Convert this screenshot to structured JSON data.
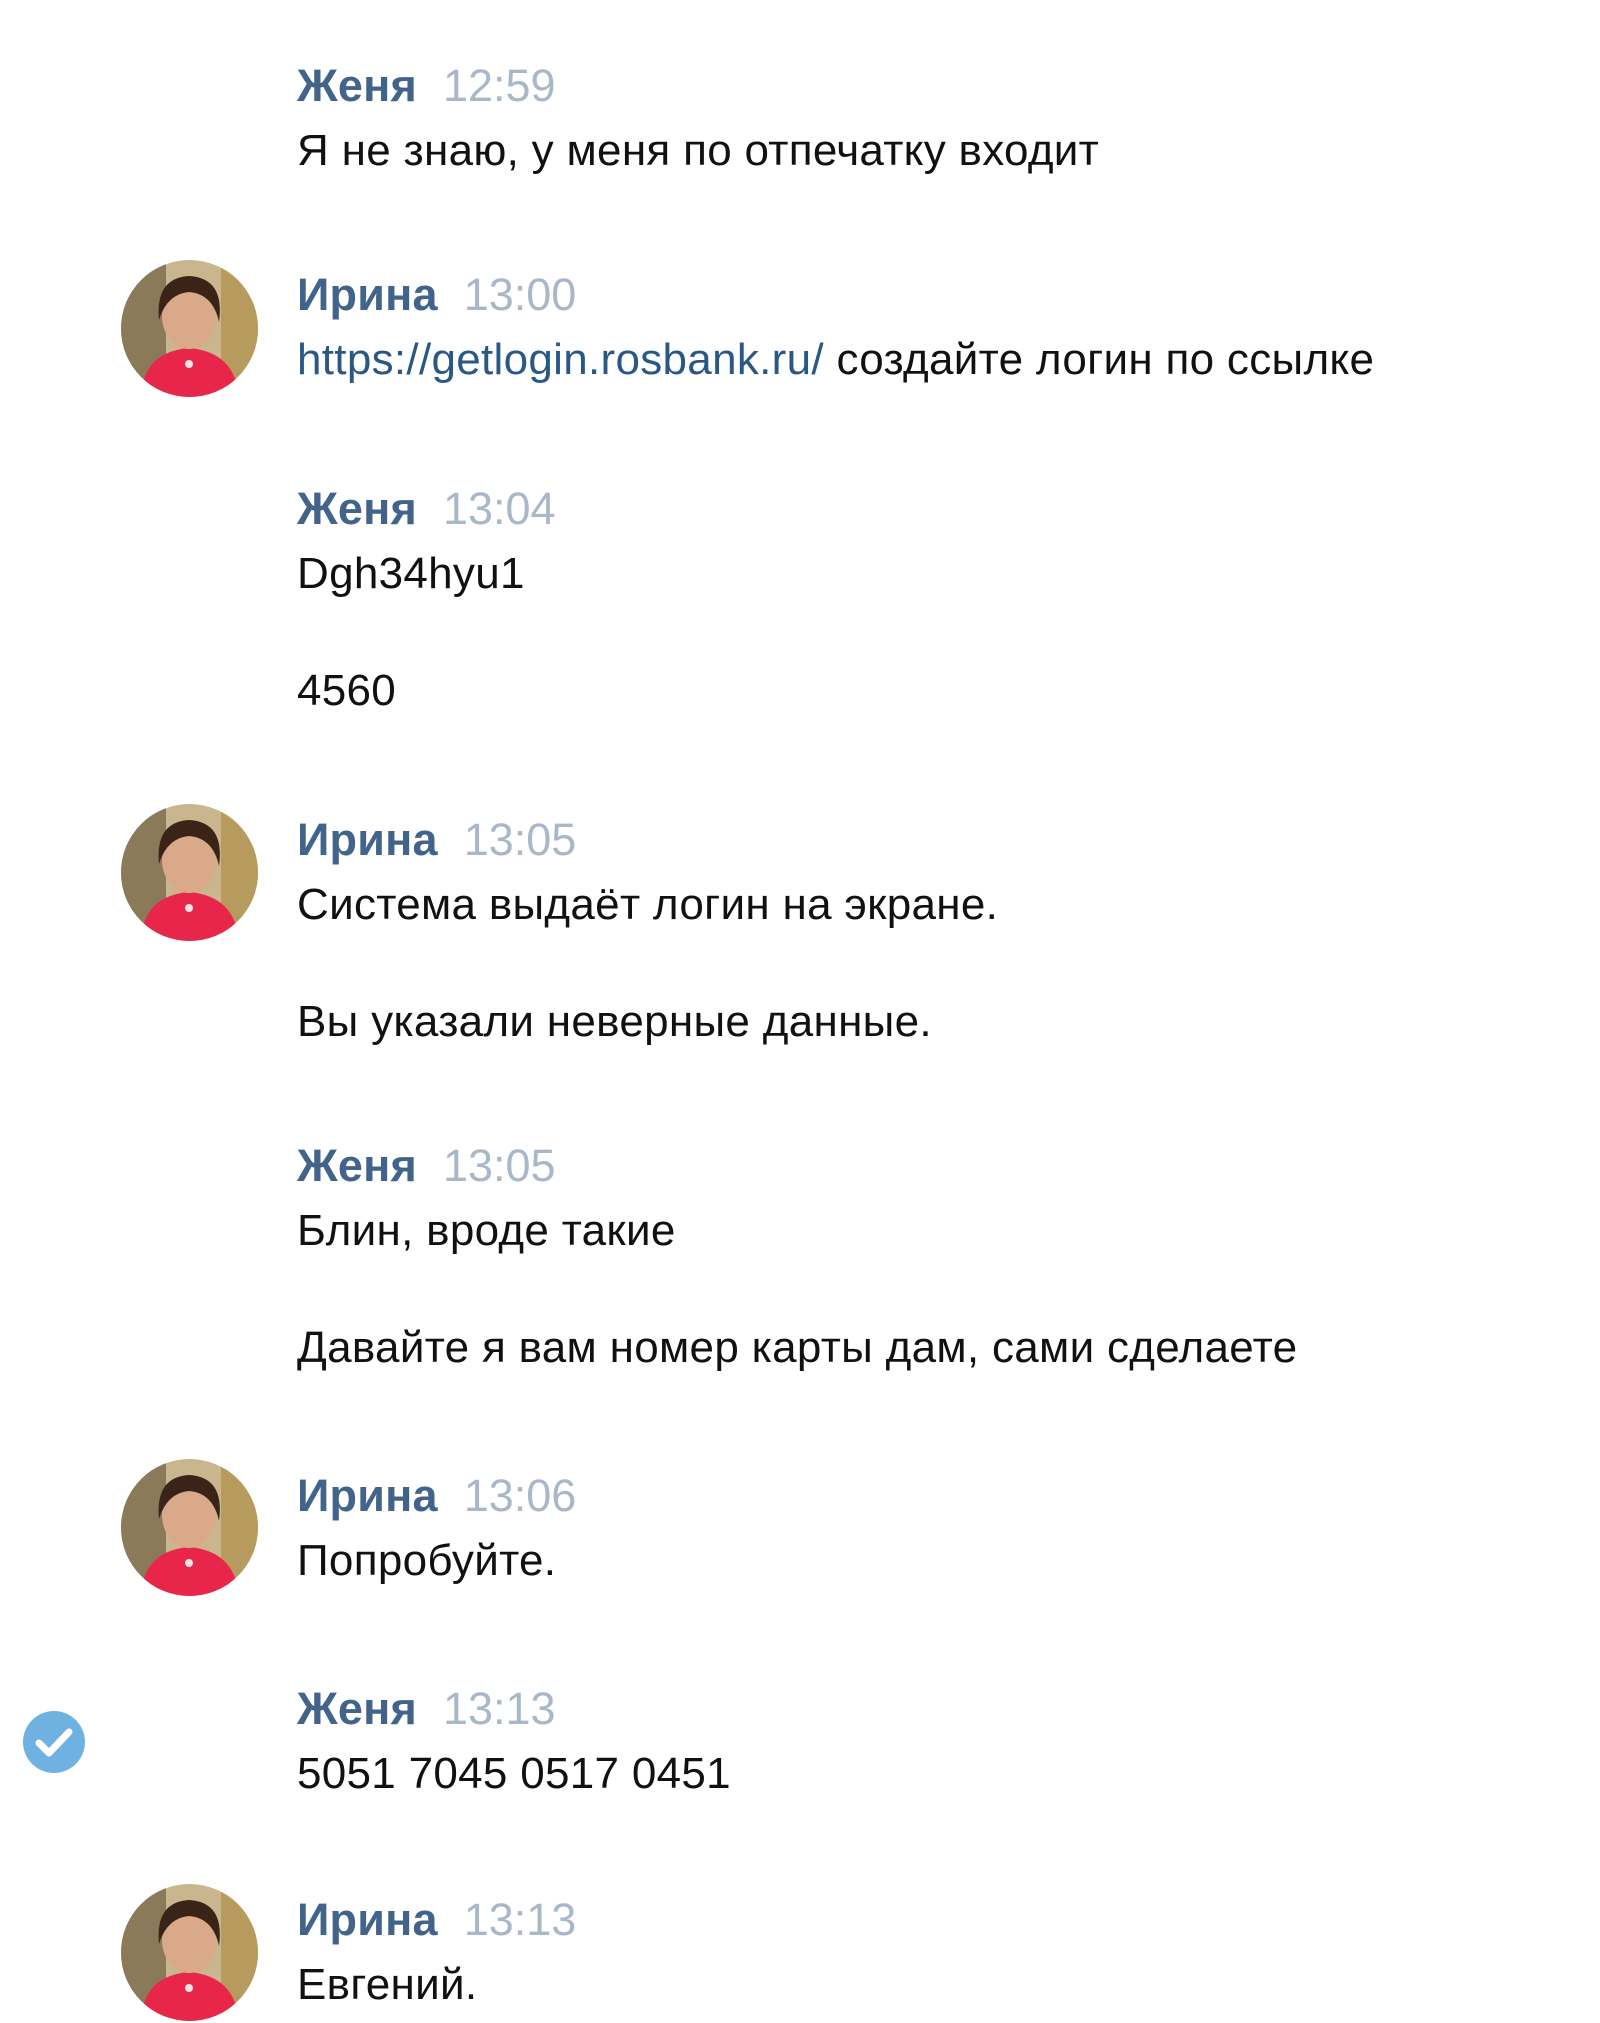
{
  "messages": [
    {
      "author": "Женя",
      "time": "12:59",
      "lines": [
        "Я не знаю, у меня по отпечатку входит"
      ]
    },
    {
      "author": "Ирина",
      "time": "13:00",
      "link": "https://getlogin.rosbank.ru/",
      "link_suffix": " создайте логин по ссылке"
    },
    {
      "author": "Женя",
      "time": "13:04",
      "lines": [
        "Dgh34hyu1",
        "4560"
      ]
    },
    {
      "author": "Ирина",
      "time": "13:05",
      "lines": [
        "Система выдаёт логин на экране.",
        "Вы указали неверные данные."
      ]
    },
    {
      "author": "Женя",
      "time": "13:05",
      "lines": [
        "Блин, вроде такие",
        "Давайте я вам номер карты дам, сами сделаете"
      ]
    },
    {
      "author": "Ирина",
      "time": "13:06",
      "lines": [
        "Попробуйте."
      ]
    },
    {
      "author": "Женя",
      "time": "13:13",
      "lines": [
        "5051 7045 0517 0451"
      ]
    },
    {
      "author": "Ирина",
      "time": "13:13",
      "lines": [
        "Евгений."
      ]
    }
  ],
  "icons": {
    "avatar": "user-avatar-photo",
    "read_status": "check-circle-icon"
  },
  "colors": {
    "author": "#42648b",
    "time": "#a9b8c8",
    "link": "#2a5885",
    "text": "#111111",
    "check": "#6fb1e0"
  }
}
